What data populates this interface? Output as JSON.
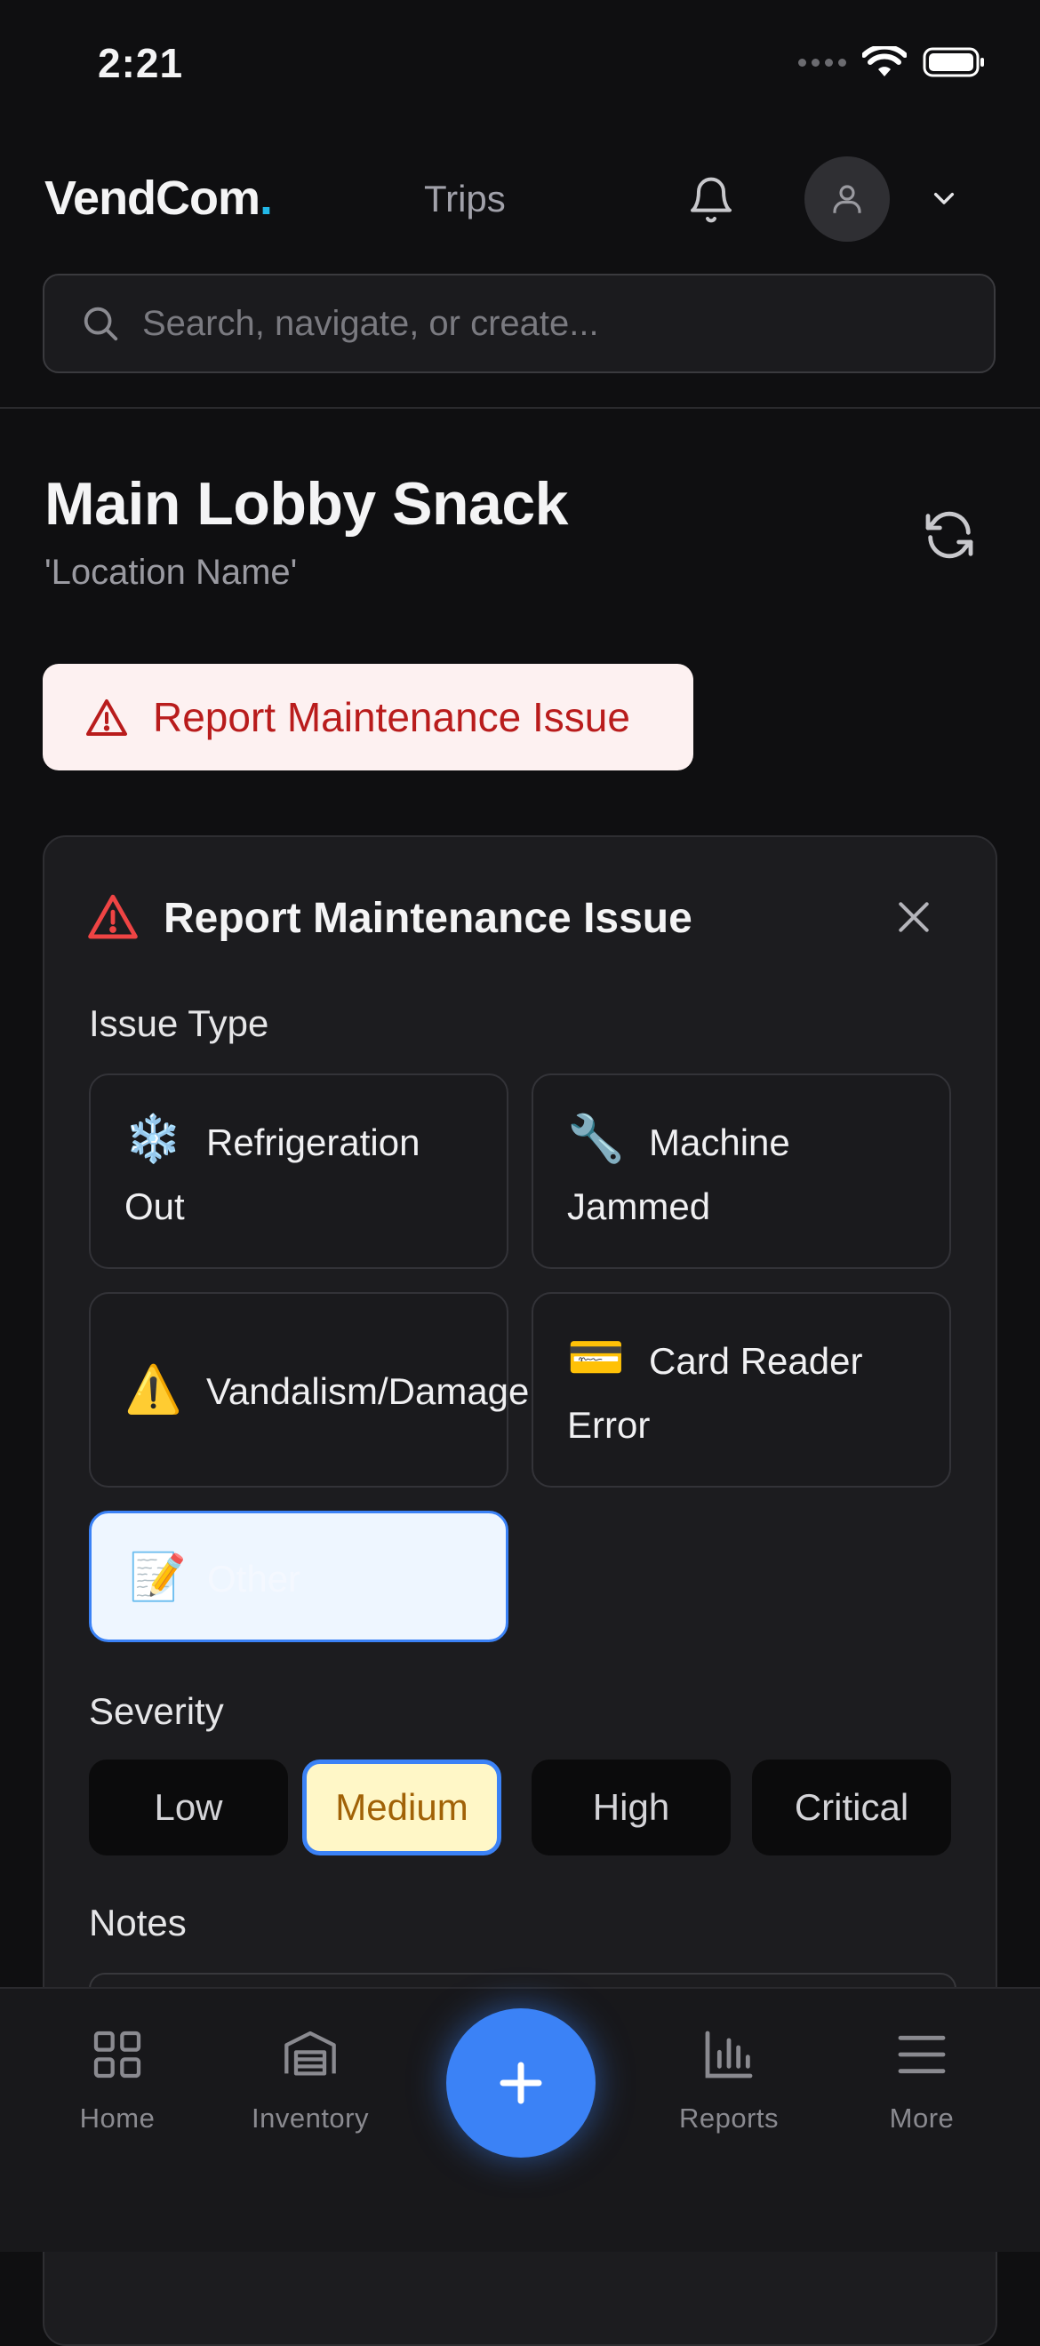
{
  "status": {
    "time": "2:21"
  },
  "header": {
    "logo": "VendCom",
    "logo_dot": ".",
    "nav_trips": "Trips",
    "search_placeholder": "Search, navigate, or create..."
  },
  "page": {
    "title": "Main Lobby Snack",
    "subtitle": "'Location Name'",
    "report_button": "Report Maintenance Issue"
  },
  "panel": {
    "title": "Report Maintenance Issue",
    "issue_type_label": "Issue Type",
    "issue_types": [
      {
        "emoji": "❄️",
        "label": "Refrigeration Out",
        "icon": "snowflake-icon"
      },
      {
        "emoji": "🔧",
        "label": "Machine Jammed",
        "icon": "wrench-icon"
      },
      {
        "emoji": "⚠️",
        "label": "Vandalism/Damage",
        "icon": "warning-icon"
      },
      {
        "emoji": "💳",
        "label": "Card Reader Error",
        "icon": "credit-card-icon"
      },
      {
        "emoji": "📝",
        "label": "Other",
        "icon": "memo-icon",
        "selected": true
      }
    ],
    "severity_label": "Severity",
    "severity_options": [
      "Low",
      "Medium",
      "High",
      "Critical"
    ],
    "severity_selected": "Medium",
    "notes_label": "Notes"
  },
  "tabbar": {
    "home": "Home",
    "inventory": "Inventory",
    "reports": "Reports",
    "more": "More"
  },
  "colors": {
    "accent": "#3b82f6",
    "danger": "#b91c1c",
    "logo_dot": "#22b8e8",
    "severity_active_bg": "#fff7c7",
    "severity_active_text": "#a16207"
  }
}
